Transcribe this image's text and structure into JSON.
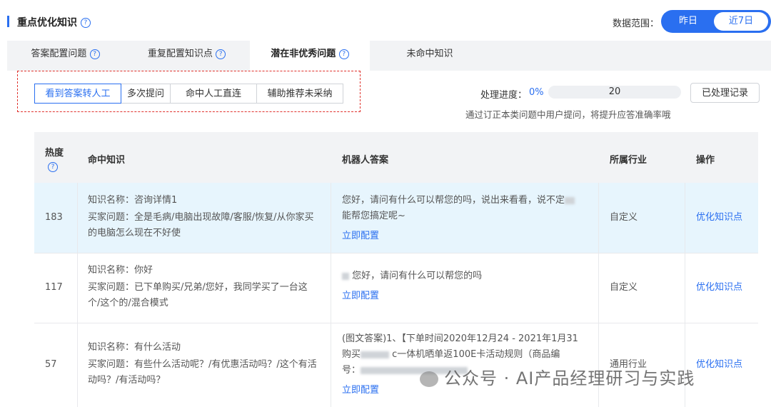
{
  "header": {
    "title": "重点优化知识",
    "help_glyph": "?",
    "range_label": "数据范围：",
    "range_options": [
      "昨日",
      "近7日"
    ],
    "range_selected": "昨日"
  },
  "tabs": [
    {
      "label": "答案配置问题",
      "help": true
    },
    {
      "label": "重复配置知识点",
      "help": true
    },
    {
      "label": "潜在非优秀问题",
      "help": true,
      "active": true
    },
    {
      "label": "未命中知识",
      "help": false
    }
  ],
  "filters": [
    "看到答案转人工",
    "多次提问",
    "命中人工直连",
    "辅助推荐未采纳"
  ],
  "filter_selected": "看到答案转人工",
  "progress": {
    "label": "处理进度：",
    "percent_text": "0%",
    "percent": 0,
    "count": "20",
    "history_button": "已处理记录",
    "hint": "通过订正本类问题中用户提问，将提升应答准确率哦"
  },
  "table": {
    "headers": {
      "heat": "热度",
      "knowledge": "命中知识",
      "answer": "机器人答案",
      "industry": "所属行业",
      "action": "操作"
    },
    "rows": [
      {
        "heat": "183",
        "name": "知识名称：咨询详情1",
        "question": "买家问题：全是毛病/电脑出现故障/客服/恢复/从你家买的电脑怎么现在不好使",
        "answer": "您好，请问有什么可以帮您的吗，说出来看看，说不定",
        "answer_tail": "能帮您搞定呢~",
        "config": "立即配置",
        "industry": "自定义",
        "action": "优化知识点"
      },
      {
        "heat": "117",
        "name": "知识名称：你好",
        "question": "买家问题：已下单购买/兄弟/您好，我同学买了一台这个/这个的/混合模式",
        "answer": "您好，请问有什么可以帮您的吗",
        "config": "立即配置",
        "industry": "自定义",
        "action": "优化知识点"
      },
      {
        "heat": "57",
        "name": "知识名称：有什么活动",
        "question": "买家问题：有些什么活动呢？/有优惠活动吗？/这个有活动吗？/有活动吗？",
        "answer_line1": "(图文答案)1、【下单时间2020年12月24 - 2021年1月31",
        "answer_line2_a": "购买",
        "answer_line2_b": "c一体机晒单返100E卡活动规则（商品编",
        "answer_line3": "号：",
        "config": "立即配置",
        "industry": "通用行业",
        "action": "优化知识点"
      }
    ]
  },
  "watermark": "公众号 · AI产品经理研习与实践"
}
